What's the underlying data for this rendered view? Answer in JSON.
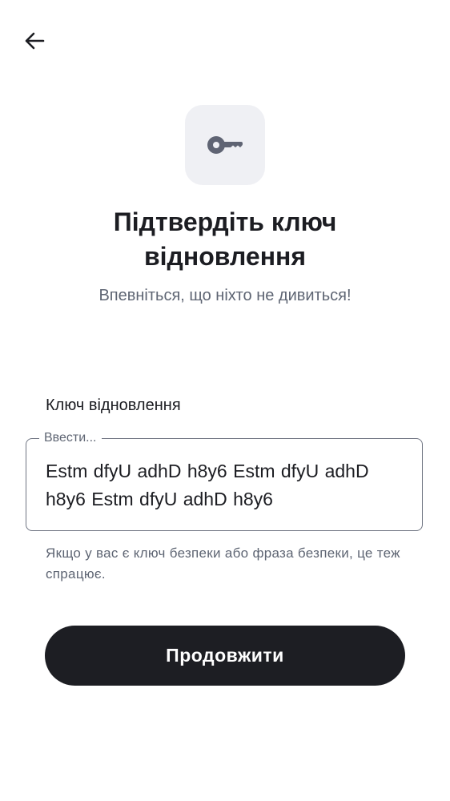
{
  "header": {
    "back_icon": "arrow-left-icon"
  },
  "hero": {
    "icon": "key-icon",
    "title": "Підтвердіть ключ відновлення",
    "subtitle": "Впевніться, що ніхто не дивиться!"
  },
  "recovery_field": {
    "label": "Ключ відновлення",
    "placeholder": "Ввести...",
    "value": "Estm dfyU adhD h8y6 Estm dfyU adhD h8y6 Estm dfyU adhD h8y6",
    "helper": "Якщо у вас є ключ безпеки або фраза безпеки, це теж спрацює."
  },
  "actions": {
    "continue_label": "Продовжити"
  },
  "colors": {
    "primary_button": "#1d1e23",
    "icon_tile": "#eff0f4",
    "icon": "#5f6473",
    "secondary_text": "#5e6573"
  }
}
